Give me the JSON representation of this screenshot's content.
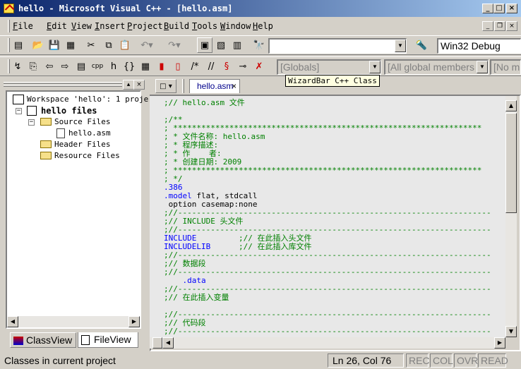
{
  "window": {
    "title": "hello - Microsoft Visual C++ - [hello.asm]"
  },
  "menu": [
    "File",
    "Edit",
    "View",
    "Insert",
    "Project",
    "Build",
    "Tools",
    "Window",
    "Help"
  ],
  "menu_hotkeys": [
    "F",
    "E",
    "V",
    "I",
    "P",
    "B",
    "T",
    "W",
    "H"
  ],
  "toolbar": {
    "find_combo_value": "",
    "config_combo_value": "Win32 Debug",
    "wizard_class_combo": "[Globals]",
    "wizard_members_combo": "[All global members",
    "wizard_third_combo": "[No m",
    "tooltip": "WizardBar C++ Class"
  },
  "workspace": {
    "root_label": "Workspace 'hello': 1 proje",
    "project_label": "hello files",
    "folders": [
      "Source Files",
      "Header Files",
      "Resource Files"
    ],
    "source_file": "hello.asm",
    "tabs": [
      "ClassView",
      "FileView"
    ]
  },
  "editor": {
    "tab_label": "hello.asm",
    "lines": [
      {
        "text": ";// hello.asm 文件",
        "style": "cm"
      },
      {
        "text": "",
        "style": "cm"
      },
      {
        "text": ";/**",
        "style": "cm"
      },
      {
        "text": "; ******************************************************************",
        "style": "cm"
      },
      {
        "text": "; * 文件名称: hello.asm",
        "style": "cm"
      },
      {
        "text": "; * 程序描述:",
        "style": "cm"
      },
      {
        "text": "; * 作    者:",
        "style": "cm"
      },
      {
        "text": "; * 创建日期: 2009",
        "style": "cm"
      },
      {
        "text": "; ******************************************************************",
        "style": "cm"
      },
      {
        "text": "; */",
        "style": "cm"
      },
      {
        "text": ".386",
        "style": "kw"
      },
      {
        "text": ".model flat, stdcall",
        "style": "mix_model"
      },
      {
        "text": " option casemap:none",
        "style": "plain"
      },
      {
        "text": ";//-------------------------------------------------------------------",
        "style": "cm"
      },
      {
        "text": ";// INCLUDE 头文件",
        "style": "cm"
      },
      {
        "text": ";//-------------------------------------------------------------------",
        "style": "cm"
      },
      {
        "text": "INCLUDE         ;// 在此插入头文件",
        "style": "mix_inc"
      },
      {
        "text": "INCLUDELIB      ;// 在此插入库文件",
        "style": "mix_inclib"
      },
      {
        "text": ";//-------------------------------------------------------------------",
        "style": "cm"
      },
      {
        "text": ";// 数据段",
        "style": "cm"
      },
      {
        "text": ";//-------------------------------------------------------------------",
        "style": "cm"
      },
      {
        "text": "    .data",
        "style": "kw"
      },
      {
        "text": ";//-------------------------------------------------------------------",
        "style": "cm"
      },
      {
        "text": ";// 在此插入变量",
        "style": "cm"
      },
      {
        "text": "",
        "style": "cm"
      },
      {
        "text": ";//-------------------------------------------------------------------",
        "style": "cm"
      },
      {
        "text": ";// 代码段",
        "style": "cm"
      },
      {
        "text": ";//-------------------------------------------------------------------",
        "style": "cm"
      },
      {
        "text": "      .",
        "style": "kw"
      }
    ]
  },
  "status": {
    "message": "Classes in current project",
    "position": "Ln 26, Col 76",
    "rec": "REC",
    "col": "COL",
    "ovr": "OVR",
    "read": "READ"
  }
}
